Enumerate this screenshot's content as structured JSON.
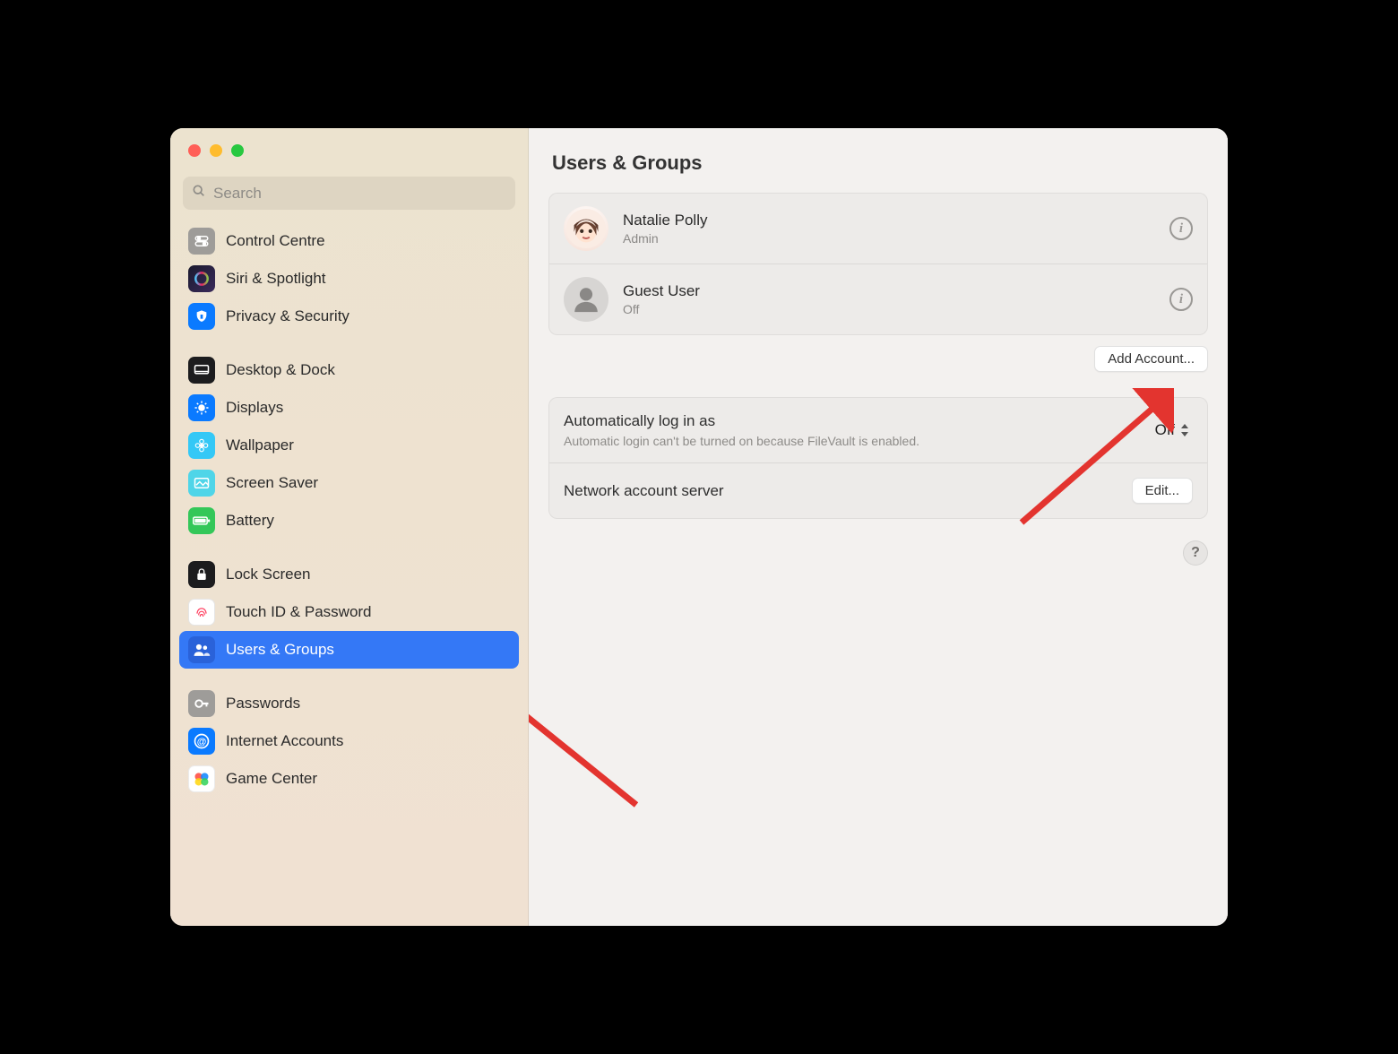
{
  "search": {
    "placeholder": "Search"
  },
  "sidebar": {
    "items": [
      {
        "label": "Control Centre"
      },
      {
        "label": "Siri & Spotlight"
      },
      {
        "label": "Privacy & Security"
      },
      {
        "label": "Desktop & Dock"
      },
      {
        "label": "Displays"
      },
      {
        "label": "Wallpaper"
      },
      {
        "label": "Screen Saver"
      },
      {
        "label": "Battery"
      },
      {
        "label": "Lock Screen"
      },
      {
        "label": "Touch ID & Password"
      },
      {
        "label": "Users & Groups"
      },
      {
        "label": "Passwords"
      },
      {
        "label": "Internet Accounts"
      },
      {
        "label": "Game Center"
      }
    ]
  },
  "main": {
    "title": "Users & Groups",
    "users": [
      {
        "name": "Natalie Polly",
        "role": "Admin"
      },
      {
        "name": "Guest User",
        "role": "Off"
      }
    ],
    "add_account_label": "Add Account...",
    "auto_login": {
      "label": "Automatically log in as",
      "desc": "Automatic login can't be turned on because FileVault is enabled.",
      "value": "Off"
    },
    "network_server": {
      "label": "Network account server",
      "button": "Edit..."
    },
    "help_label": "?"
  }
}
